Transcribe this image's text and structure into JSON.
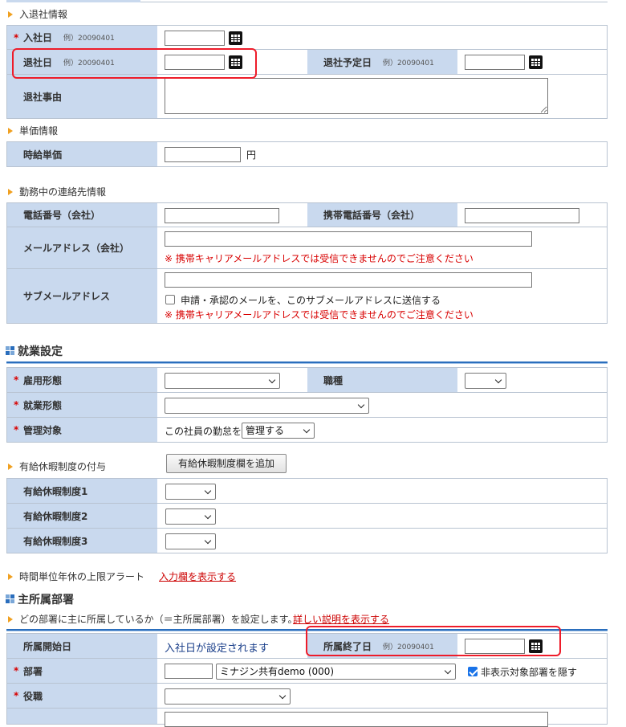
{
  "sections": {
    "entry_exit": "入退社情報",
    "unit_price": "単価情報",
    "contact": "勤務中の連絡先情報",
    "paid_leave_grant": "有給休暇制度の付与",
    "hourly_leave_alert": "時間単位年休の上限アラート"
  },
  "entry_exit": {
    "join_date_label": "入社日",
    "join_date_example": "例）20090401",
    "leave_date_label": "退社日",
    "leave_date_example": "例）20090401",
    "planned_leave_label": "退社予定日",
    "planned_leave_example": "例）20090401",
    "leave_reason_label": "退社事由"
  },
  "unit": {
    "hourly_label": "時給単価",
    "yen": "円"
  },
  "contact": {
    "phone_label": "電話番号（会社）",
    "mobile_label": "携帯電話番号（会社）",
    "email_label": "メールアドレス（会社）",
    "email_warning": "※ 携帯キャリアメールアドレスでは受信できませんのでご注意ください",
    "sub_email_label": "サブメールアドレス",
    "sub_email_checkbox": "申請・承認のメールを、このサブメールアドレスに送信する",
    "sub_email_warning": "※ 携帯キャリアメールアドレスでは受信できませんのでご注意ください"
  },
  "employment": {
    "heading": "就業設定",
    "type_label": "雇用形態",
    "job_label": "職種",
    "work_form_label": "就業形態",
    "managed_label": "管理対象",
    "managed_prefix": "この社員の勤怠を",
    "managed_value": "管理する"
  },
  "paid_leave": {
    "add_button": "有給休暇制度欄を追加",
    "row1": "有給休暇制度1",
    "row2": "有給休暇制度2",
    "row3": "有給休暇制度3"
  },
  "alert": {
    "show_link": "入力欄を表示する"
  },
  "main_dept": {
    "heading": "主所属部署",
    "description": "どの部署に主に所属しているか（＝主所属部署）を設定します。",
    "detail_link": "詳しい説明を表示する",
    "start_label": "所属開始日",
    "start_value": "入社日が設定されます",
    "end_label": "所属終了日",
    "end_example": "例）20090401",
    "dept_label": "部署",
    "dept_value": "ミナジン共有demo (000)",
    "hide_checkbox": "非表示対象部署を隠す",
    "position_label": "役職"
  },
  "colors": {
    "header_bg": "#c9d9ee",
    "required": "#d80000",
    "highlight": "#ee1c2a",
    "section_rule": "#2a6ebd"
  }
}
